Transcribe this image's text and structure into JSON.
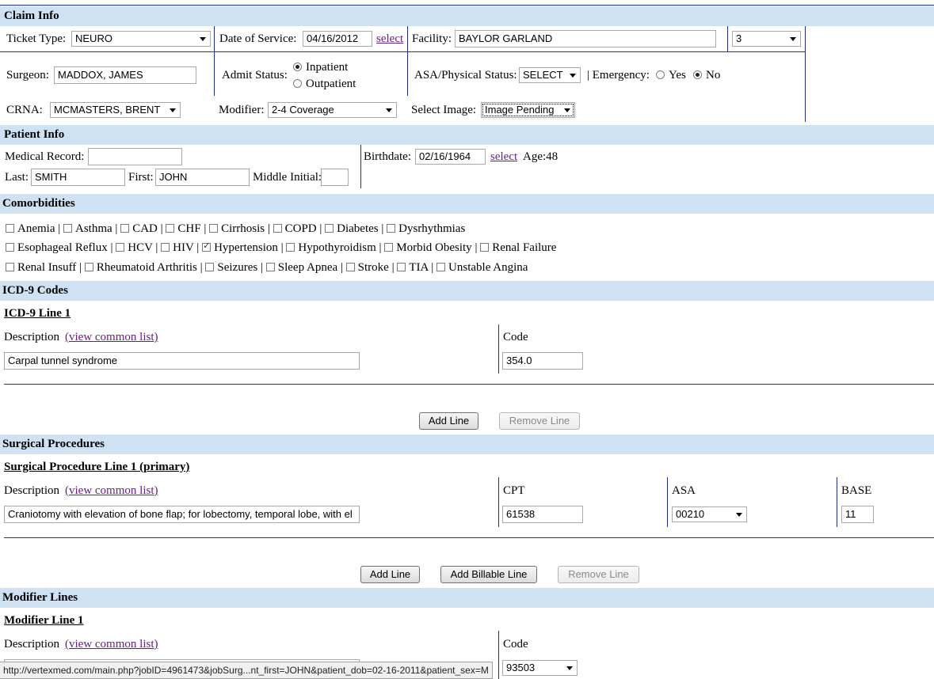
{
  "claim_info": {
    "header": "Claim Info",
    "ticket_type_label": "Ticket Type:",
    "ticket_type_value": "NEURO",
    "dos_label": "Date of Service:",
    "dos_value": "04/16/2012",
    "dos_select": "select",
    "facility_label": "Facility:",
    "facility_value": "BAYLOR GARLAND",
    "facility_num": "3",
    "surgeon_label": "Surgeon:",
    "surgeon_value": "MADDOX, JAMES",
    "admit_label": "Admit Status:",
    "admit_options": [
      "Inpatient",
      "Outpatient"
    ],
    "admit_selected": "Inpatient",
    "asa_label": "ASA/Physical Status:",
    "asa_value": "SELECT",
    "emergency_label": "| Emergency:",
    "emergency_options": [
      "Yes",
      "No"
    ],
    "emergency_selected": "No",
    "crna_label": "CRNA:",
    "crna_value": "MCMASTERS, BRENT",
    "modifier_label": "Modifier:",
    "modifier_value": "2-4 Coverage",
    "image_label": "Select Image:",
    "image_value": "Image Pending"
  },
  "patient_info": {
    "header": "Patient Info",
    "mrn_label": "Medical Record:",
    "mrn_value": "",
    "last_label": "Last:",
    "last_value": "SMITH",
    "first_label": "First:",
    "first_value": "JOHN",
    "mi_label": "Middle Initial:",
    "mi_value": "",
    "birthdate_label": "Birthdate:",
    "birthdate_value": "02/16/1964",
    "birthdate_select": "select",
    "age_text": "Age:48"
  },
  "comorbidities": {
    "header": "Comorbidities",
    "rows": [
      [
        {
          "label": "Anemia",
          "checked": false
        },
        {
          "label": "Asthma",
          "checked": false
        },
        {
          "label": "CAD",
          "checked": false
        },
        {
          "label": "CHF",
          "checked": false
        },
        {
          "label": "Cirrhosis",
          "checked": false
        },
        {
          "label": "COPD",
          "checked": false
        },
        {
          "label": "Diabetes",
          "checked": false
        },
        {
          "label": "Dysrhythmias",
          "checked": false
        }
      ],
      [
        {
          "label": "Esophageal Reflux",
          "checked": false
        },
        {
          "label": "HCV",
          "checked": false
        },
        {
          "label": "HIV",
          "checked": false
        },
        {
          "label": "Hypertension",
          "checked": true
        },
        {
          "label": "Hypothyroidism",
          "checked": false
        },
        {
          "label": "Morbid Obesity",
          "checked": false
        },
        {
          "label": "Renal Failure",
          "checked": false
        }
      ],
      [
        {
          "label": "Renal Insuff",
          "checked": false
        },
        {
          "label": "Rheumatoid Arthritis",
          "checked": false
        },
        {
          "label": "Seizures",
          "checked": false
        },
        {
          "label": "Sleep Apnea",
          "checked": false
        },
        {
          "label": "Stroke",
          "checked": false
        },
        {
          "label": "TIA",
          "checked": false
        },
        {
          "label": "Unstable Angina",
          "checked": false
        }
      ]
    ]
  },
  "icd9": {
    "header": "ICD-9 Codes",
    "line_title": "ICD-9 Line 1",
    "desc_label": "Description",
    "view_list": "(view common list)",
    "code_label": "Code",
    "desc_value": "Carpal tunnel syndrome",
    "code_value": "354.0",
    "add_line": "Add Line",
    "remove_line": "Remove Line"
  },
  "surgical": {
    "header": "Surgical Procedures",
    "line_title": "Surgical Procedure Line 1 (primary)",
    "desc_label": "Description",
    "view_list": "(view common list)",
    "cpt_label": "CPT",
    "asa_label": "ASA",
    "base_label": "BASE",
    "desc_value": "Craniotomy with elevation of bone flap; for lobectomy, temporal lobe, with el",
    "cpt_value": "61538",
    "asa_value": "00210",
    "base_value": "11",
    "add_line": "Add Line",
    "add_billable": "Add Billable Line",
    "remove_line": "Remove Line"
  },
  "modifier_lines": {
    "header": "Modifier Lines",
    "line_title": "Modifier Line 1",
    "desc_label": "Description",
    "view_list": "(view common list)",
    "code_label": "Code",
    "code_value": "93503"
  },
  "status_bar": {
    "url": "http://vertexmed.com/main.php?jobID=4961473&jobSurg...nt_first=JOHN&patient_dob=02-16-2011&patient_sex=M"
  }
}
